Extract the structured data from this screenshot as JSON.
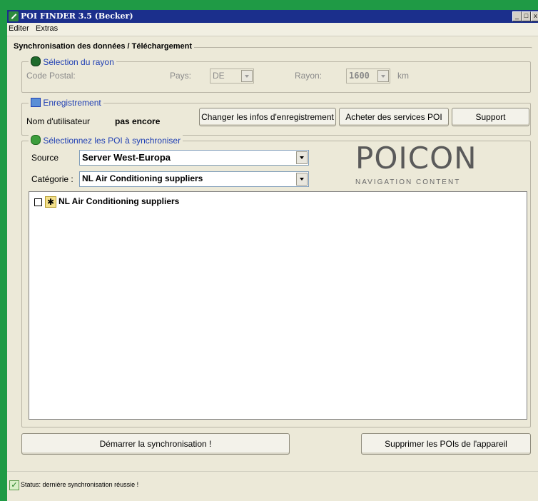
{
  "window": {
    "title": "POI FINDER 3.5 (Becker)",
    "controls": [
      "_",
      "□",
      "x"
    ]
  },
  "menu": {
    "items": [
      "Editer",
      "Extras"
    ]
  },
  "sync_section": {
    "title": "Synchronisation des données / Téléchargement",
    "radius": {
      "title": "Sélection du rayon",
      "postal_label": "Code Postal:",
      "country_label": "Pays:",
      "country_value": "DE",
      "radius_label": "Rayon:",
      "radius_value": "1600",
      "unit": "km"
    },
    "registration": {
      "title": "Enregistrement",
      "user_label": "Nom d'utilisateur",
      "user_value": "pas encore",
      "change_button": "Changer les infos d'enregistrement",
      "buy_button": "Acheter des services POI",
      "support_button": "Support"
    },
    "poi": {
      "title": "Sélectionnez les POI à synchroniser",
      "source_label": "Source",
      "source_value": "Server West-Europa",
      "category_label": "Catégorie :",
      "category_value": "NL Air Conditioning suppliers",
      "logo_text": "POICON",
      "logo_sub": "NAVIGATION CONTENT",
      "tree_items": [
        {
          "label": "NL Air Conditioning suppliers",
          "checked": false
        }
      ]
    }
  },
  "actions": {
    "start_button": "Démarrer la synchronisation !",
    "delete_button": "Supprimer les POIs de l'appareil"
  },
  "status": {
    "text": "Status: dernière synchronisation réussie !"
  },
  "colors": {
    "background_green": "#1f9a45",
    "titlebar": "#1b2f8c",
    "window_face": "#ece9d8",
    "group_blue": "#1f3fb3"
  }
}
